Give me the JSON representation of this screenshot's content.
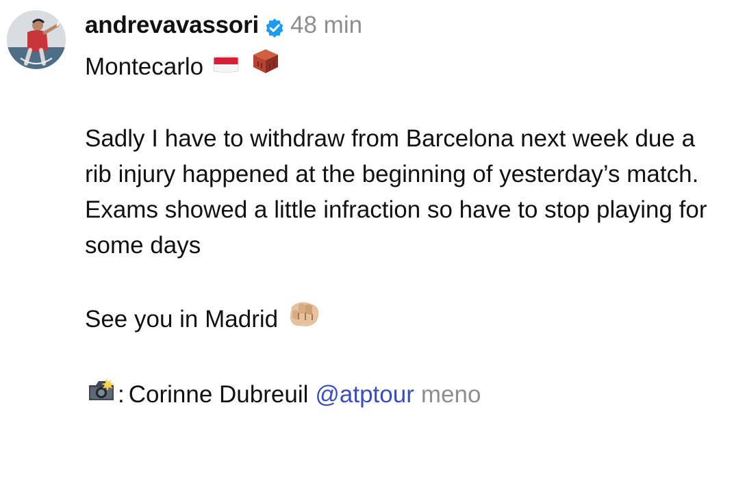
{
  "post": {
    "username": "andrevavassori",
    "timestamp": "48 min",
    "verified_icon": "verified-badge-icon",
    "avatar_icon": "profile-avatar"
  },
  "caption": {
    "first_line": "Montecarlo",
    "first_line_emojis": [
      "monaco-flag-icon",
      "brick-icon"
    ],
    "body": "Sadly I have to withdraw from Barcelona next week due a rib injury happened at the beginning of yesterday’s match. Exams showed a little infraction so have to stop playing for some days",
    "closing": "See you in Madrid",
    "closing_emoji": "fist-bump-icon",
    "credit_icon": "camera-flash-icon",
    "credit_separator": ":",
    "credit_name": "Corinne Dubreuil",
    "mention": "@atptour",
    "more_label": "meno"
  },
  "colors": {
    "text": "#111111",
    "muted": "#8e8e8e",
    "mention": "#3a4dbf",
    "verified": "#1d9bf0"
  }
}
